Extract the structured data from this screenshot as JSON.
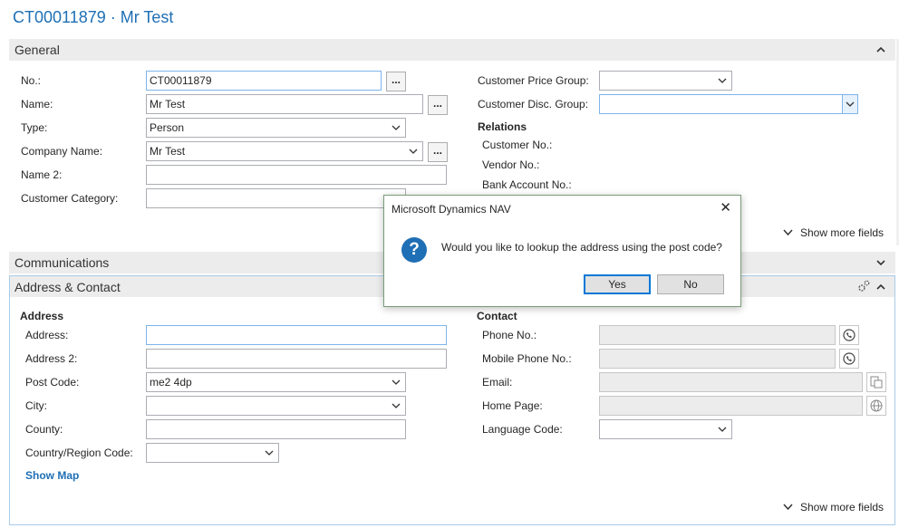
{
  "page": {
    "title": "CT00011879 · Mr Test"
  },
  "general": {
    "header": "General",
    "fields": {
      "no": {
        "label": "No.:",
        "value": "CT00011879"
      },
      "name": {
        "label": "Name:",
        "value": "Mr Test"
      },
      "type": {
        "label": "Type:",
        "value": "Person"
      },
      "company_name": {
        "label": "Company Name:",
        "value": "Mr Test"
      },
      "name2": {
        "label": "Name 2:",
        "value": ""
      },
      "customer_category": {
        "label": "Customer Category:",
        "value": ""
      },
      "customer_price_group": {
        "label": "Customer Price Group:",
        "value": ""
      },
      "customer_disc_group": {
        "label": "Customer Disc. Group:",
        "value": ""
      }
    },
    "relations": {
      "heading": "Relations",
      "customer_no": "Customer No.:",
      "vendor_no": "Vendor No.:",
      "bank_account_no": "Bank Account No.:"
    },
    "show_more": "Show more fields",
    "lookup_button": "..."
  },
  "communications": {
    "header": "Communications"
  },
  "address_contact": {
    "header": "Address & Contact",
    "address": {
      "heading": "Address",
      "address_label": "Address:",
      "address_value": "",
      "address2_label": "Address 2:",
      "address2_value": "",
      "post_code_label": "Post Code:",
      "post_code_value": "me2 4dp",
      "city_label": "City:",
      "city_value": "",
      "county_label": "County:",
      "county_value": "",
      "country_label": "Country/Region Code:",
      "country_value": ""
    },
    "show_map": "Show Map",
    "contact": {
      "heading": "Contact",
      "phone_label": "Phone No.:",
      "phone_value": "",
      "mobile_label": "Mobile Phone No.:",
      "mobile_value": "",
      "email_label": "Email:",
      "email_value": "",
      "homepage_label": "Home Page:",
      "homepage_value": "",
      "language_label": "Language Code:",
      "language_value": ""
    },
    "show_more": "Show more fields"
  },
  "dialog": {
    "title": "Microsoft Dynamics NAV",
    "message": "Would you like to lookup the address using the post code?",
    "yes_label": "Yes",
    "no_label": "No",
    "close_glyph": "✕",
    "question_glyph": "?"
  },
  "icons": {
    "phone": "phone-icon",
    "email": "email-icon",
    "globe": "globe-icon",
    "settings": "customize-icon"
  },
  "colors": {
    "accent": "#1e6fb5",
    "dialog_border": "#7a9a7a",
    "default_button": "#0078d7",
    "question": "#1e6fb5"
  }
}
